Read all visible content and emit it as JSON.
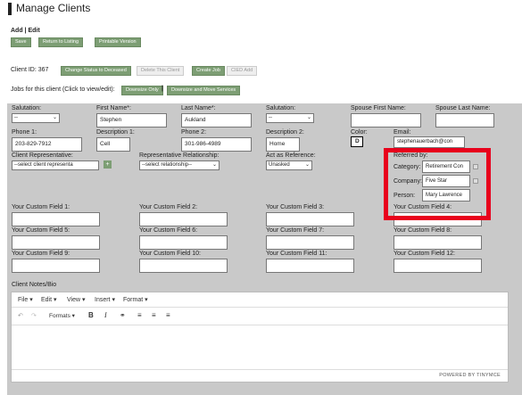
{
  "page": {
    "title": "Manage Clients",
    "add_edit": "Add | Edit",
    "buttons": {
      "save": "Save",
      "return": "Return to Listing",
      "printable": "Printable Version"
    },
    "client_id_label": "Client ID: 367",
    "client_buttons": {
      "change_status": "Change Status to Deceased",
      "delete": "Delete This Client",
      "create_job": "Create Job",
      "cied_add": "CIED Add"
    },
    "jobs_label": "Jobs for this client (Click to view/edit):",
    "jobs_buttons": {
      "downsize_only": "Downsize Only",
      "downsize_move": "Downsize and Move Services"
    }
  },
  "form": {
    "salutation": {
      "label": "Salutation:",
      "value": "--"
    },
    "first_name": {
      "label": "First Name*:",
      "value": "Stephen"
    },
    "last_name": {
      "label": "Last Name*:",
      "value": "Aukland"
    },
    "salutation2": {
      "label": "Salutation:",
      "value": "--"
    },
    "spouse_first": {
      "label": "Spouse First Name:",
      "value": ""
    },
    "spouse_last": {
      "label": "Spouse Last Name:",
      "value": ""
    },
    "phone1": {
      "label": "Phone 1:",
      "value": "203-829-7912"
    },
    "desc1": {
      "label": "Description 1:",
      "value": "Cell"
    },
    "phone2": {
      "label": "Phone 2:",
      "value": "301-986-4989"
    },
    "desc2": {
      "label": "Description 2:",
      "value": "Home"
    },
    "color": {
      "label": "Color:",
      "value": "D"
    },
    "email": {
      "label": "Email:",
      "value": "stephenauerbach@con"
    },
    "client_rep": {
      "label": "Client Representative:",
      "value": "--select client representa"
    },
    "rep_relationship": {
      "label": "Representative Relationship:",
      "value": "--select relationship--"
    },
    "act_as_reference": {
      "label": "Act as Reference:",
      "value": "Unasked"
    },
    "referred_by": {
      "label": "Referred by:",
      "category": {
        "label": "Category:",
        "value": "Retirement Con"
      },
      "company": {
        "label": "Company:",
        "value": "Five Star"
      },
      "person": {
        "label": "Person:",
        "value": "Mary Lawrence"
      }
    },
    "custom_fields": [
      "Your Custom Field 1:",
      "Your Custom Field 2:",
      "Your Custom Field 3:",
      "Your Custom Field 4:",
      "Your Custom Field 5:",
      "Your Custom Field 6:",
      "Your Custom Field 7:",
      "Your Custom Field 8:",
      "Your Custom Field 9:",
      "Your Custom Field 10:",
      "Your Custom Field 11:",
      "Your Custom Field 12:"
    ],
    "notes_label": "Client Notes/Bio"
  },
  "editor": {
    "menu": [
      "File",
      "Edit",
      "View",
      "Insert",
      "Format"
    ],
    "formats_label": "Formats",
    "status": "POWERED BY TINYMCE"
  },
  "colors": {
    "accent_green": "#7d9e74",
    "highlight_red": "#e8001c",
    "panel_gray": "#c9c9c9"
  }
}
